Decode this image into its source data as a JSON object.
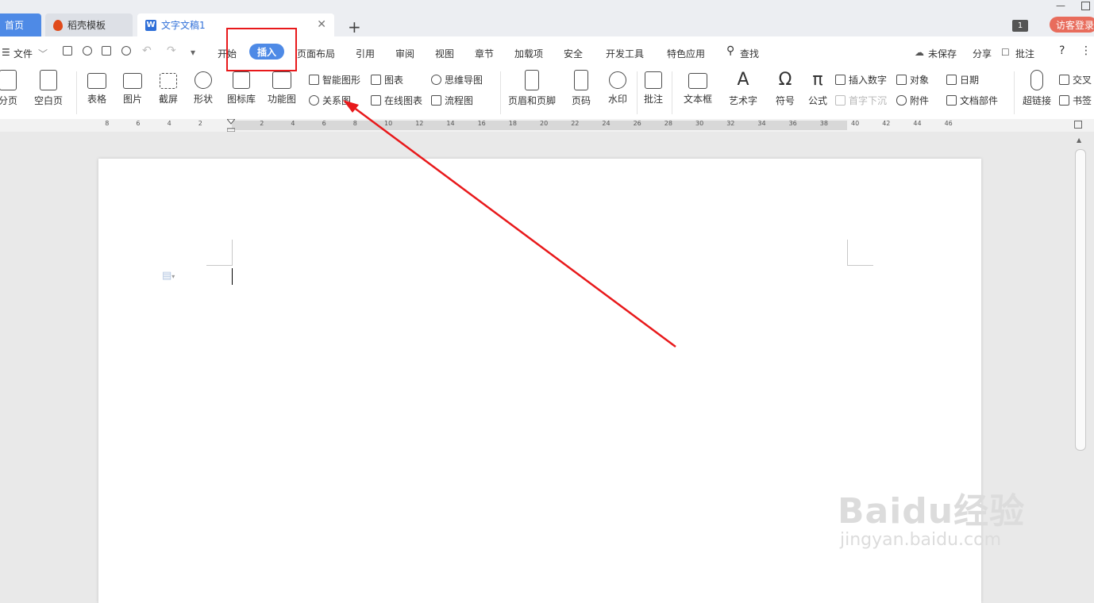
{
  "tabs": {
    "home": "首页",
    "template": "稻壳模板",
    "document": "文字文稿1"
  },
  "window": {
    "badge": "1",
    "login": "访客登录"
  },
  "menubar": {
    "file": "文件",
    "items": [
      "开始",
      "插入",
      "页面布局",
      "引用",
      "审阅",
      "视图",
      "章节",
      "加载项",
      "安全",
      "开发工具",
      "特色应用"
    ],
    "search": "查找",
    "unsaved": "未保存",
    "share": "分享",
    "comment": "批注",
    "help": "?",
    "more": "⋮"
  },
  "ribbon": {
    "page_break": "分页",
    "blank_page": "空白页",
    "table": "表格",
    "picture": "图片",
    "screenshot": "截屏",
    "shape": "形状",
    "icon_lib": "图标库",
    "func_chart": "功能图",
    "smart_shape": "智能图形",
    "chart": "图表",
    "mindmap": "思维导图",
    "relation": "关系图",
    "online_chart": "在线图表",
    "flowchart": "流程图",
    "header_footer": "页眉和页脚",
    "page_number": "页码",
    "watermark": "水印",
    "comment": "批注",
    "textbox": "文本框",
    "wordart": "艺术字",
    "symbol": "符号",
    "formula": "公式",
    "insert_number": "插入数字",
    "drop_cap": "首字下沉",
    "object": "对象",
    "attachment": "附件",
    "date": "日期",
    "doc_parts": "文档部件",
    "hyperlink": "超链接",
    "cross_ref": "交叉",
    "bookmark": "书签"
  },
  "ruler": {
    "left_ticks": [
      "8",
      "6",
      "4",
      "2"
    ],
    "right_ticks": [
      "2",
      "4",
      "6",
      "8",
      "10",
      "12",
      "14",
      "16",
      "18",
      "20",
      "22",
      "24",
      "26",
      "28",
      "30",
      "32",
      "34",
      "36",
      "38",
      "40",
      "42",
      "44",
      "46"
    ]
  },
  "watermark": {
    "logo": "Baidu经验",
    "url": "jingyan.baidu.com"
  },
  "annotation": {
    "color": "#e8191b"
  }
}
